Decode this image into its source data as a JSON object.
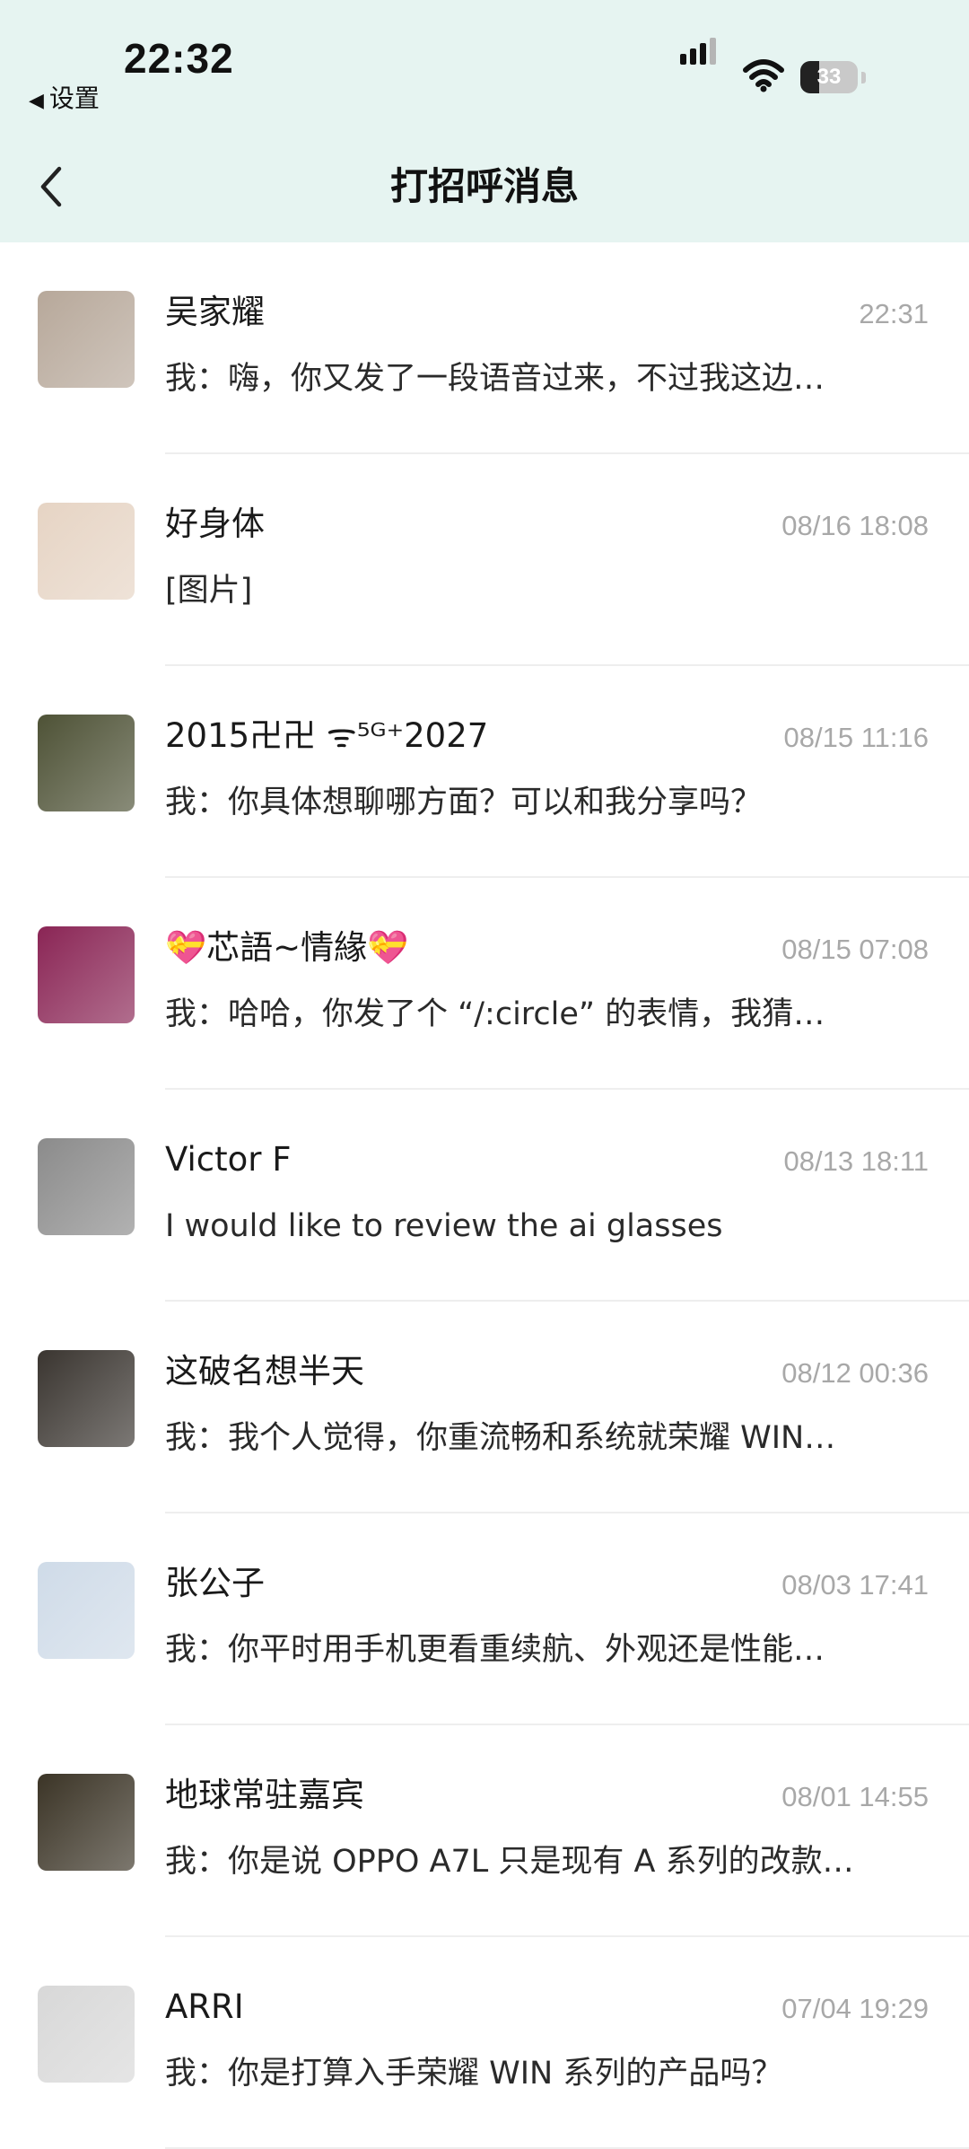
{
  "status_bar": {
    "time": "22:32",
    "back_app": "设置",
    "battery": "33",
    "battery_level": 0.33
  },
  "header": {
    "title": "打招呼消息"
  },
  "conversations": [
    {
      "name": "吴家耀",
      "time": "22:31",
      "preview": "我：嗨，你又发了一段语音过来，不过我这边…",
      "avatar_icon": "family-photo-avatar",
      "avatar_color": "#b7a89a"
    },
    {
      "name": "好身体",
      "time": "08/16 18:08",
      "preview": "[图片]",
      "avatar_icon": "baby-photo-avatar",
      "avatar_color": "#e6d4c4"
    },
    {
      "name": "2015卍卍 ᯤ⁵ᴳ⁺2027",
      "time": "08/15 11:16",
      "preview": "我：你具体想聊哪方面？可以和我分享吗？",
      "avatar_icon": "camo-soldier-avatar",
      "avatar_color": "#4e5236"
    },
    {
      "name": "💝芯語~情緣💝",
      "time": "08/15 07:08",
      "preview": "我：哈哈，你发了个 “/:circle” 的表情，我猜…",
      "avatar_icon": "costume-portrait-avatar",
      "avatar_color": "#8a2555"
    },
    {
      "name": "Victor F",
      "time": "08/13 18:11",
      "preview": "I would like to review the ai glasses",
      "avatar_icon": "man-portrait-avatar",
      "avatar_color": "#8b8b8b"
    },
    {
      "name": "这破名想半天",
      "time": "08/12 00:36",
      "preview": "我：我个人觉得，你重流畅和系统就荣耀 WIN…",
      "avatar_icon": "photo-grid-avatar",
      "avatar_color": "#3a3530"
    },
    {
      "name": "张公子",
      "time": "08/03 17:41",
      "preview": "我：你平时用手机更看重续航、外观还是性能…",
      "avatar_icon": "boy-with-cat-avatar",
      "avatar_color": "#cfdbe8"
    },
    {
      "name": "地球常驻嘉宾",
      "time": "08/01 14:55",
      "preview": "我：你是说 OPPO A7L 只是现有 A 系列的改款…",
      "avatar_icon": "sunglasses-man-avatar",
      "avatar_color": "#3b3426"
    },
    {
      "name": "ARRI",
      "time": "07/04 19:29",
      "preview": "我：你是打算入手荣耀 WIN 系列的产品吗？",
      "avatar_icon": "man-with-camera-avatar",
      "avatar_color": "#d8d8d8"
    }
  ]
}
